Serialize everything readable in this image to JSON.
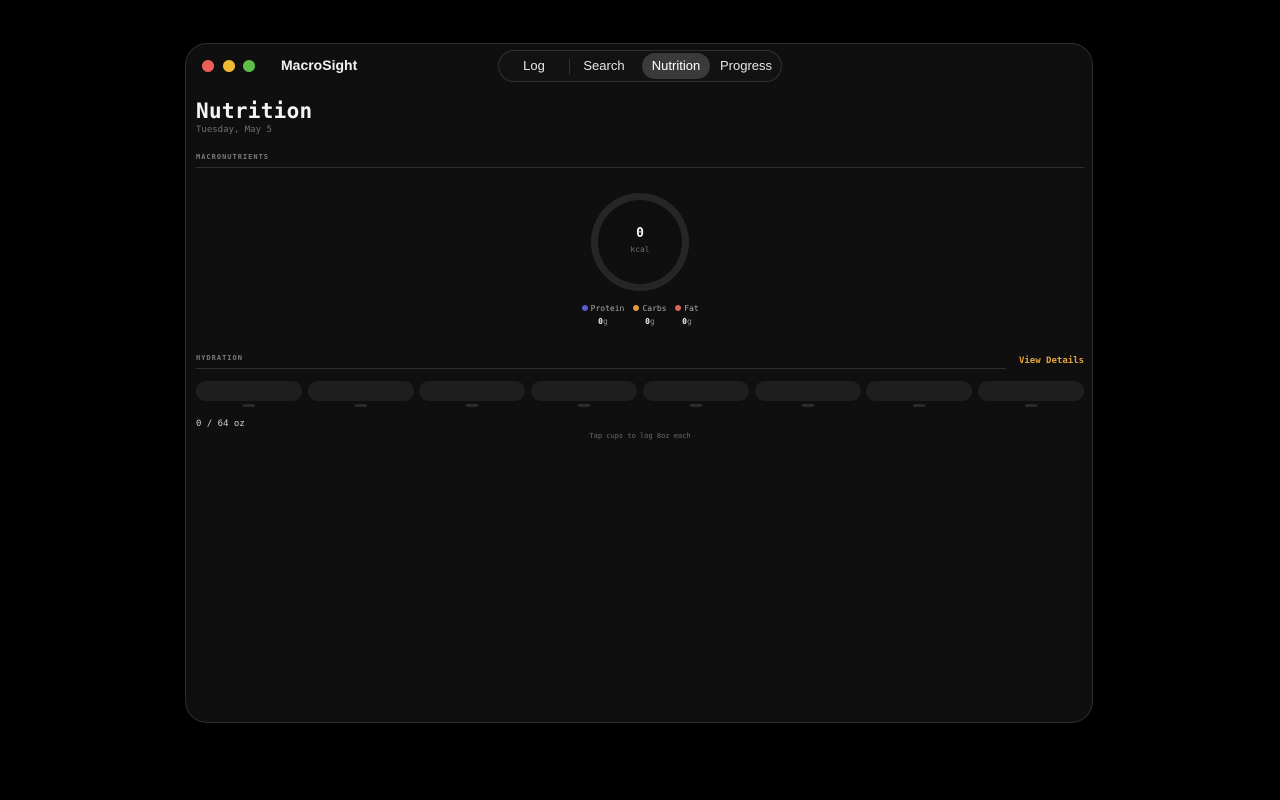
{
  "app": {
    "title": "MacroSight"
  },
  "tabs": [
    {
      "label": "Log",
      "active": false
    },
    {
      "label": "Search",
      "active": false
    },
    {
      "label": "Nutrition",
      "active": true
    },
    {
      "label": "Progress",
      "active": false
    }
  ],
  "page": {
    "title": "Nutrition",
    "date": "Tuesday, May 5"
  },
  "macros": {
    "section_label": "MACRONUTRIENTS",
    "calories": "0",
    "calories_unit": "kcal",
    "legend": [
      {
        "name": "Protein",
        "value": "0",
        "unit": "g",
        "color": "#5b5bd6"
      },
      {
        "name": "Carbs",
        "value": "0",
        "unit": "g",
        "color": "#e39a3a"
      },
      {
        "name": "Fat",
        "value": "0",
        "unit": "g",
        "color": "#e0605a"
      }
    ]
  },
  "hydration": {
    "section_label": "HYDRATION",
    "view_details": "View Details",
    "cups_filled": 0,
    "cups_total": 8,
    "total_text": "0 / 64 oz",
    "hint": "Tap cups to log 8oz each"
  },
  "colors": {
    "accent": "#e5a23a",
    "active_tab": "#3a3a3a",
    "window_bg": "#0f0f0f"
  }
}
